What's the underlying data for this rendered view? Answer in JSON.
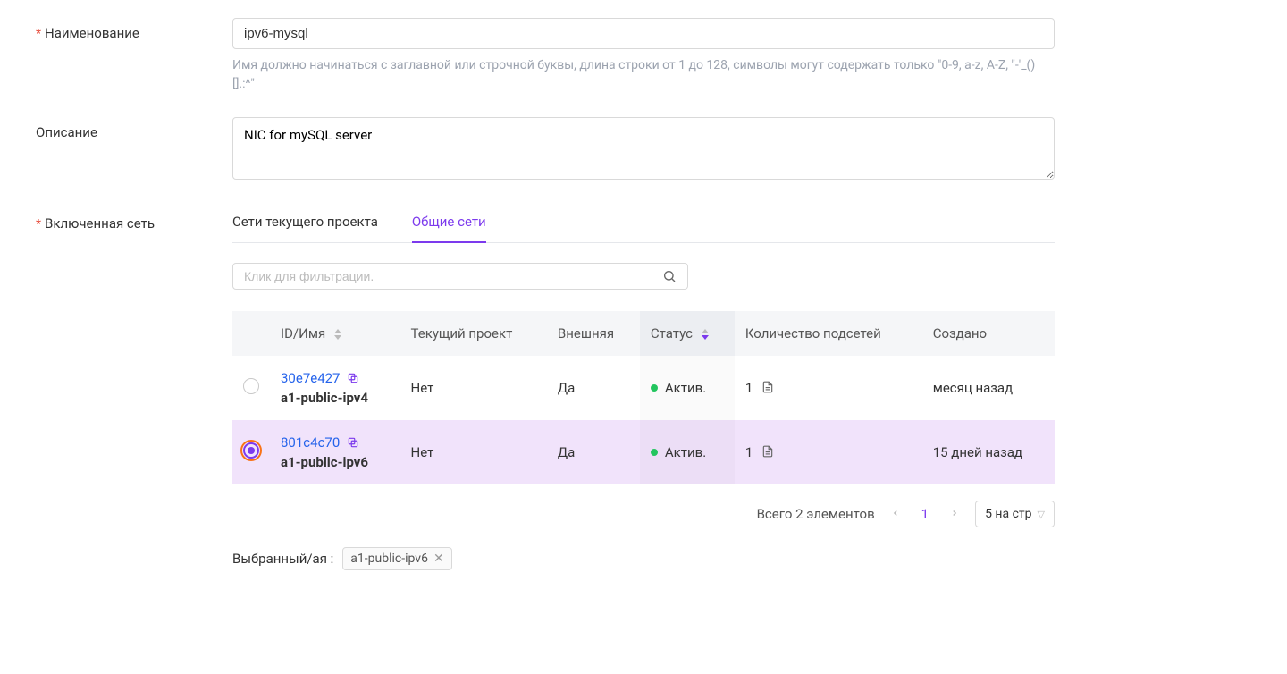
{
  "form": {
    "name_label": "Наименование",
    "name_value": "ipv6-mysql",
    "name_hint": "Имя должно начинаться с заглавной или строчной буквы, длина строки от 1 до 128, символы могут содержать только \"0-9, a-z, A-Z, \"-'_()[].:^\"",
    "description_label": "Описание",
    "description_value": "NIC for mySQL server",
    "network_label": "Включенная сеть"
  },
  "tabs": {
    "current": "Сети текущего проекта",
    "shared": "Общие сети"
  },
  "filter": {
    "placeholder": "Клик для фильтрации."
  },
  "table": {
    "columns": {
      "id_name": "ID/Имя",
      "project": "Текущий проект",
      "external": "Внешняя",
      "status": "Статус",
      "subnets": "Количество подсетей",
      "created": "Создано"
    },
    "rows": [
      {
        "id": "30e7e427",
        "name": "a1-public-ipv4",
        "project": "Нет",
        "external": "Да",
        "status": "Актив.",
        "subnets": "1",
        "created": "месяц назад",
        "selected": false
      },
      {
        "id": "801c4c70",
        "name": "a1-public-ipv6",
        "project": "Нет",
        "external": "Да",
        "status": "Актив.",
        "subnets": "1",
        "created": "15 дней назад",
        "selected": true
      }
    ]
  },
  "pagination": {
    "total_text": "Всего 2 элементов",
    "page": "1",
    "page_size": "5 на стр"
  },
  "selection": {
    "label": "Выбранный/ая :",
    "value": "a1-public-ipv6"
  }
}
